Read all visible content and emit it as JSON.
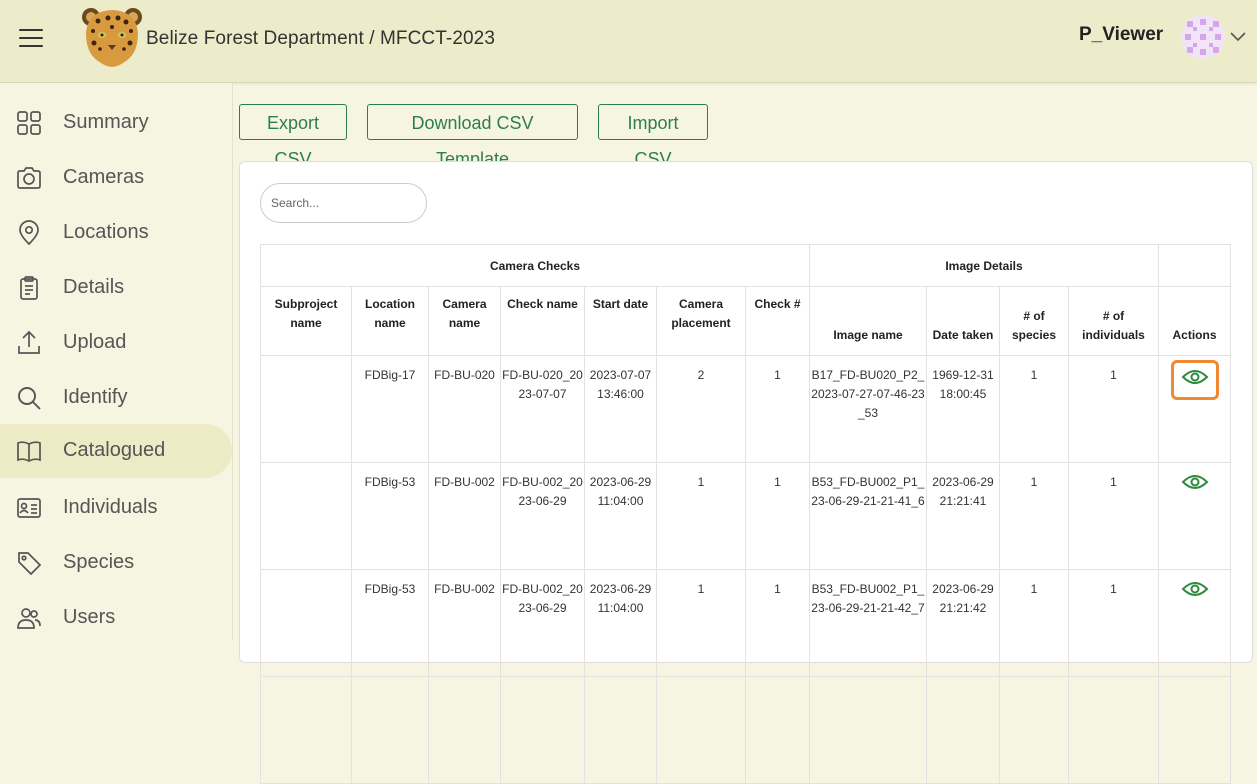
{
  "header": {
    "title": "Belize Forest Department / MFCCT-2023",
    "username": "P_Viewer",
    "menu_icon": "hamburger-icon",
    "logo": "jaguar-logo",
    "avatar_icon": "avatar-pattern",
    "dropdown_icon": "chevron-down-icon"
  },
  "sidebar": {
    "items": [
      {
        "label": "Summary",
        "icon": "grid-icon"
      },
      {
        "label": "Cameras",
        "icon": "camera-icon"
      },
      {
        "label": "Locations",
        "icon": "map-pin-icon"
      },
      {
        "label": "Details",
        "icon": "clipboard-icon"
      },
      {
        "label": "Upload",
        "icon": "upload-icon"
      },
      {
        "label": "Identify",
        "icon": "search-icon"
      },
      {
        "label": "Catalogued",
        "icon": "book-icon",
        "active": true
      },
      {
        "label": "Individuals",
        "icon": "id-card-icon"
      },
      {
        "label": "Species",
        "icon": "tag-icon"
      },
      {
        "label": "Users",
        "icon": "users-icon"
      }
    ]
  },
  "toolbar": {
    "export_label": "Export CSV",
    "template_label": "Download CSV Template",
    "import_label": "Import CSV"
  },
  "search": {
    "placeholder": "Search..."
  },
  "table": {
    "groups": [
      "Camera Checks",
      "Image Details"
    ],
    "columns": [
      "Subproject name",
      "Location name",
      "Camera name",
      "Check name",
      "Start date",
      "Camera placement",
      "Check #",
      "Image name",
      "Date taken",
      "# of species",
      "# of individuals",
      "Actions"
    ],
    "rows": [
      {
        "subproject": "",
        "location": "FDBig-17",
        "camera": "FD-BU-020",
        "check": "FD-BU-020_2023-07-07",
        "start": "2023-07-07 13:46:00",
        "placement": "2",
        "check_no": "1",
        "image": "B17_FD-BU020_P2_2023-07-27-07-46-23_53",
        "date_taken": "1969-12-31 18:00:45",
        "species": "1",
        "individuals": "1",
        "action_icon": "eye-icon"
      },
      {
        "subproject": "",
        "location": "FDBig-53",
        "camera": "FD-BU-002",
        "check": "FD-BU-002_2023-06-29",
        "start": "2023-06-29 11:04:00",
        "placement": "1",
        "check_no": "1",
        "image": "B53_FD-BU002_P1_23-06-29-21-21-41_6",
        "date_taken": "2023-06-29 21:21:41",
        "species": "1",
        "individuals": "1",
        "action_icon": "eye-icon"
      },
      {
        "subproject": "",
        "location": "FDBig-53",
        "camera": "FD-BU-002",
        "check": "FD-BU-002_2023-06-29",
        "start": "2023-06-29 11:04:00",
        "placement": "1",
        "check_no": "1",
        "image": "B53_FD-BU002_P1_23-06-29-21-21-42_7",
        "date_taken": "2023-06-29 21:21:42",
        "species": "1",
        "individuals": "1",
        "action_icon": "eye-icon"
      }
    ]
  },
  "colors": {
    "header_bg": "#ecebca",
    "page_bg": "#f6f5e2",
    "accent_green": "#2e7d4f",
    "focus_orange": "#f08a32"
  }
}
